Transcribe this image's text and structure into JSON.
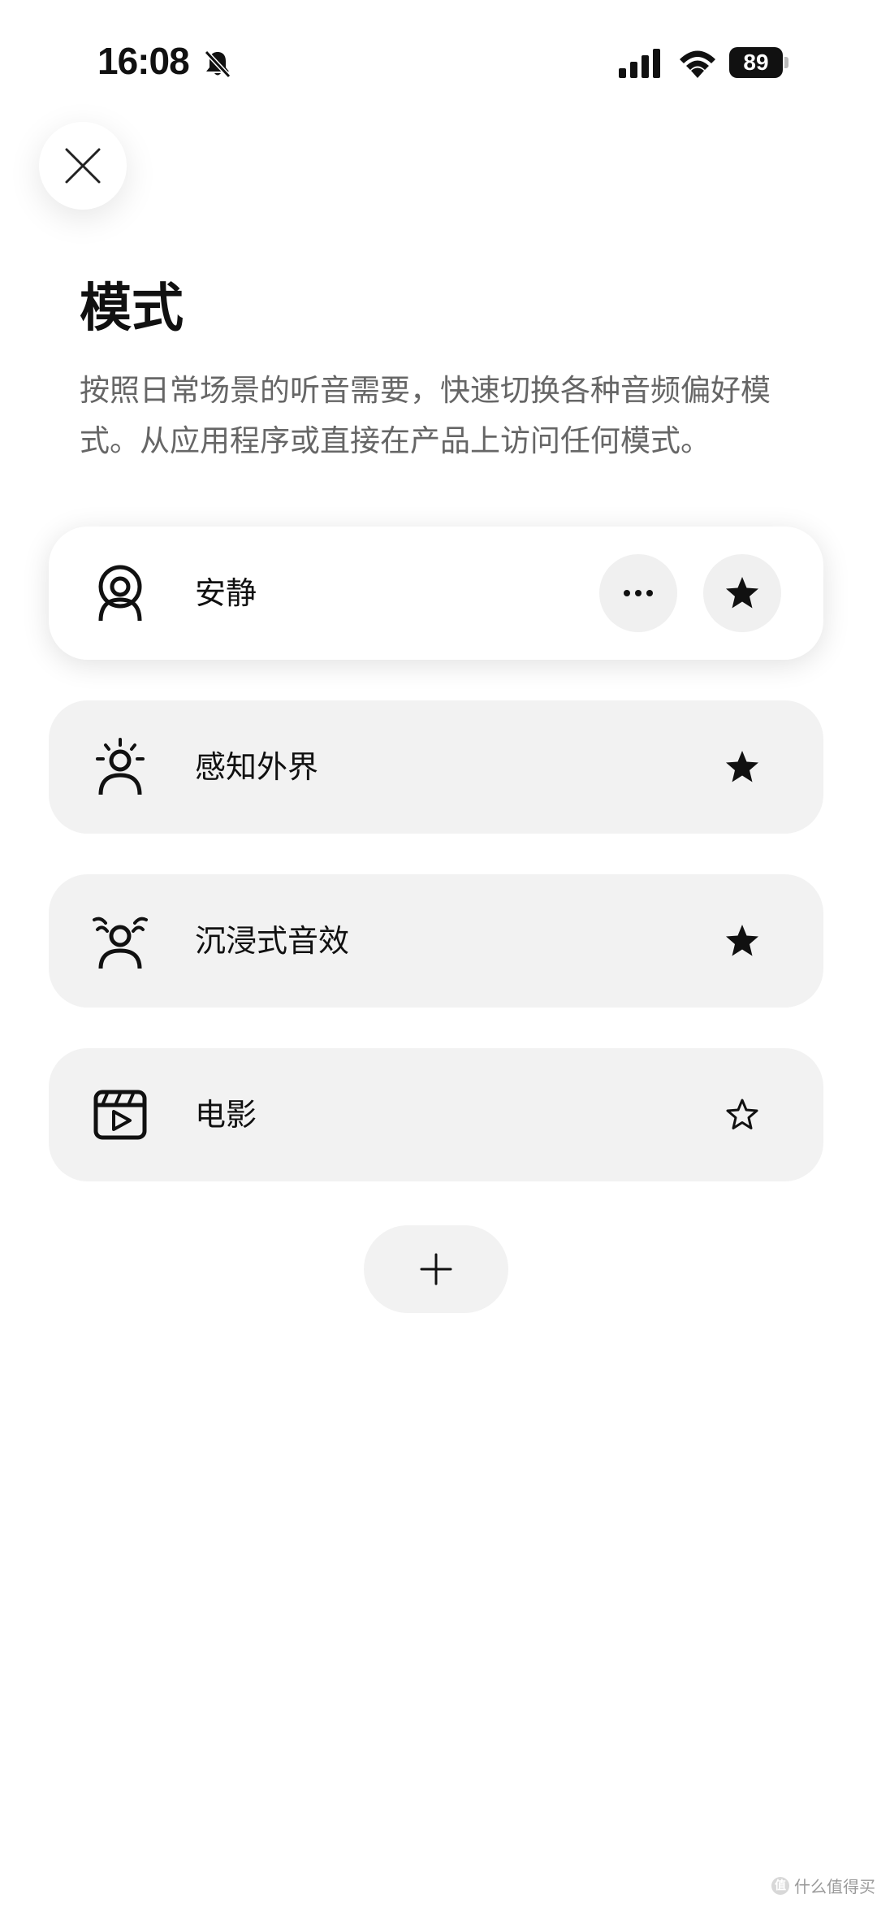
{
  "status_bar": {
    "time": "16:08",
    "battery": "89"
  },
  "header": {
    "title": "模式",
    "description": "按照日常场景的听音需要，快速切换各种音频偏好模式。从应用程序或直接在产品上访问任何模式。"
  },
  "modes": [
    {
      "label": "安静",
      "icon": "noise-cancelling-person-icon",
      "active": true,
      "favorite": true
    },
    {
      "label": "感知外界",
      "icon": "transparency-person-icon",
      "active": false,
      "favorite": true
    },
    {
      "label": "沉浸式音效",
      "icon": "immersive-person-icon",
      "active": false,
      "favorite": true
    },
    {
      "label": "电影",
      "icon": "movie-clapper-icon",
      "active": false,
      "favorite": false
    }
  ],
  "watermark": {
    "text": "什么值得买",
    "logo": "值"
  },
  "colors": {
    "background": "#ffffff",
    "card": "#f2f2f2",
    "text": "#111111",
    "secondary_text": "#666666"
  }
}
